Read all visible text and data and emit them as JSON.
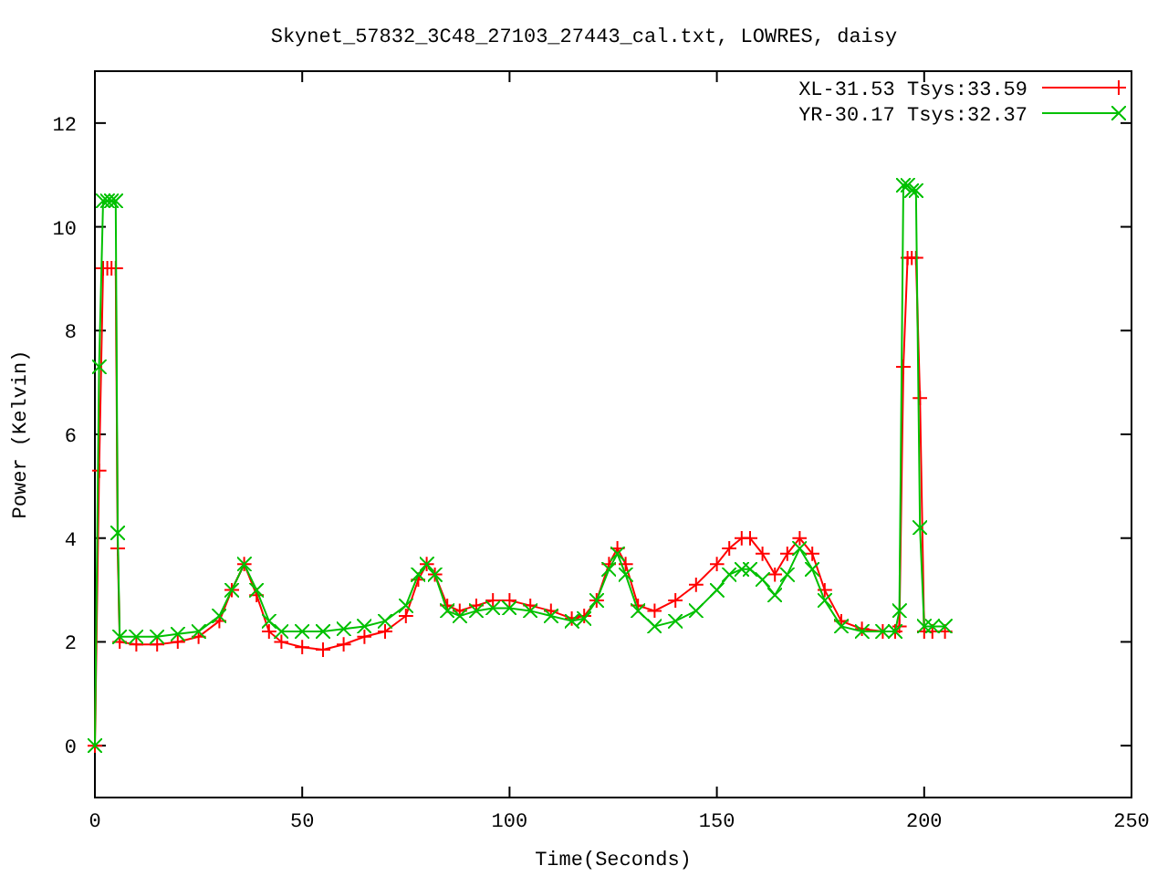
{
  "plot": {
    "chart_data": {
      "type": "line",
      "title": "Skynet_57832_3C48_27103_27443_cal.txt, LOWRES, daisy",
      "xlabel": "Time(Seconds)",
      "ylabel": "Power (Kelvin)",
      "x": [
        0,
        1,
        2,
        3,
        4,
        5,
        5.5,
        6,
        10,
        15,
        20,
        25,
        30,
        33,
        36,
        39,
        42,
        45,
        50,
        55,
        60,
        65,
        70,
        75,
        78,
        80,
        82,
        85,
        88,
        92,
        96,
        100,
        105,
        110,
        115,
        118,
        121,
        124,
        126,
        128,
        131,
        135,
        140,
        145,
        150,
        153,
        156,
        158,
        161,
        164,
        167,
        170,
        173,
        176,
        180,
        185,
        190,
        193,
        194,
        195,
        196,
        197,
        198,
        199,
        200,
        202,
        205
      ],
      "legend": true,
      "xlim": [
        0,
        250
      ],
      "ylim": [
        -1,
        13
      ],
      "xticks": [
        0,
        50,
        100,
        150,
        200,
        250
      ],
      "yticks": [
        0,
        2,
        4,
        6,
        8,
        10,
        12
      ],
      "series": [
        {
          "name": "XL-31.53 Tsys:33.59",
          "color": "#ff0000",
          "values": [
            0,
            5.3,
            9.2,
            9.2,
            9.2,
            9.2,
            3.8,
            2.0,
            1.95,
            1.95,
            2.0,
            2.1,
            2.4,
            3.0,
            3.5,
            2.9,
            2.2,
            2.0,
            1.9,
            1.85,
            1.95,
            2.1,
            2.2,
            2.5,
            3.2,
            3.5,
            3.3,
            2.7,
            2.6,
            2.7,
            2.8,
            2.8,
            2.7,
            2.6,
            2.45,
            2.5,
            2.8,
            3.5,
            3.8,
            3.5,
            2.7,
            2.6,
            2.8,
            3.1,
            3.5,
            3.8,
            4.0,
            4.0,
            3.7,
            3.3,
            3.7,
            4.0,
            3.7,
            3.0,
            2.4,
            2.25,
            2.2,
            2.2,
            2.3,
            7.3,
            9.4,
            9.4,
            9.4,
            6.7,
            2.2,
            2.2,
            2.2
          ]
        },
        {
          "name": "YR-30.17 Tsys:32.37",
          "color": "#00c000",
          "values": [
            0,
            7.3,
            10.5,
            10.5,
            10.5,
            10.5,
            4.1,
            2.1,
            2.1,
            2.1,
            2.15,
            2.2,
            2.5,
            3.0,
            3.5,
            3.0,
            2.4,
            2.2,
            2.2,
            2.2,
            2.25,
            2.3,
            2.4,
            2.7,
            3.3,
            3.5,
            3.3,
            2.6,
            2.5,
            2.6,
            2.65,
            2.65,
            2.6,
            2.5,
            2.4,
            2.45,
            2.8,
            3.4,
            3.7,
            3.3,
            2.6,
            2.3,
            2.4,
            2.6,
            3.0,
            3.3,
            3.4,
            3.4,
            3.2,
            2.9,
            3.3,
            3.8,
            3.4,
            2.8,
            2.3,
            2.2,
            2.2,
            2.2,
            2.6,
            10.8,
            10.8,
            10.7,
            10.7,
            4.2,
            2.3,
            2.3,
            2.3
          ]
        }
      ]
    }
  }
}
